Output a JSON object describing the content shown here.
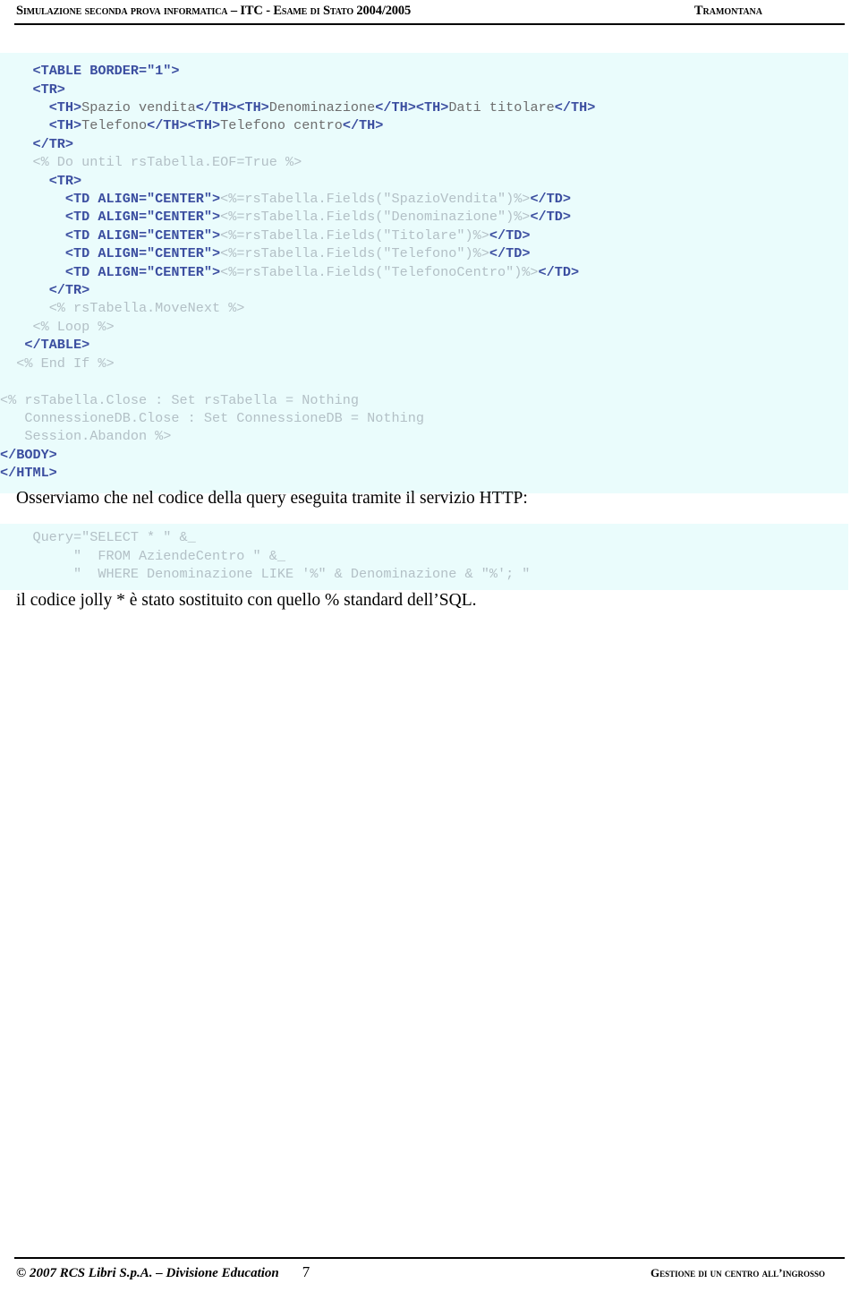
{
  "header": {
    "title": "Simulazione seconda prova informatica – ITC - Esame di Stato 2004/2005",
    "publisher": "Tramontana"
  },
  "code_block_1": {
    "lines": [
      [
        {
          "t": "plain",
          "v": "    "
        },
        {
          "t": "tag",
          "v": "<TABLE BORDER=\"1\">"
        }
      ],
      [
        {
          "t": "plain",
          "v": "    "
        },
        {
          "t": "tag",
          "v": "<TR>"
        }
      ],
      [
        {
          "t": "plain",
          "v": "      "
        },
        {
          "t": "tag",
          "v": "<TH>"
        },
        {
          "t": "text",
          "v": "Spazio vendita"
        },
        {
          "t": "tag",
          "v": "</TH><TH>"
        },
        {
          "t": "text",
          "v": "Denominazione"
        },
        {
          "t": "tag",
          "v": "</TH><TH>"
        },
        {
          "t": "text",
          "v": "Dati titolare"
        },
        {
          "t": "tag",
          "v": "</TH>"
        }
      ],
      [
        {
          "t": "plain",
          "v": "      "
        },
        {
          "t": "tag",
          "v": "<TH>"
        },
        {
          "t": "text",
          "v": "Telefono"
        },
        {
          "t": "tag",
          "v": "</TH><TH>"
        },
        {
          "t": "text",
          "v": "Telefono centro"
        },
        {
          "t": "tag",
          "v": "</TH>"
        }
      ],
      [
        {
          "t": "plain",
          "v": "    "
        },
        {
          "t": "tag",
          "v": "</TR>"
        }
      ],
      [
        {
          "t": "plain",
          "v": "    "
        },
        {
          "t": "asp",
          "v": "<% Do until rsTabella.EOF=True %>"
        }
      ],
      [
        {
          "t": "plain",
          "v": "      "
        },
        {
          "t": "tag",
          "v": "<TR>"
        }
      ],
      [
        {
          "t": "plain",
          "v": "        "
        },
        {
          "t": "tag",
          "v": "<TD ALIGN=\"CENTER\">"
        },
        {
          "t": "asp",
          "v": "<%=rsTabella.Fields(\"SpazioVendita\")%>"
        },
        {
          "t": "tag",
          "v": "</TD>"
        }
      ],
      [
        {
          "t": "plain",
          "v": "        "
        },
        {
          "t": "tag",
          "v": "<TD ALIGN=\"CENTER\">"
        },
        {
          "t": "asp",
          "v": "<%=rsTabella.Fields(\"Denominazione\")%>"
        },
        {
          "t": "tag",
          "v": "</TD>"
        }
      ],
      [
        {
          "t": "plain",
          "v": "        "
        },
        {
          "t": "tag",
          "v": "<TD ALIGN=\"CENTER\">"
        },
        {
          "t": "asp",
          "v": "<%=rsTabella.Fields(\"Titolare\")%>"
        },
        {
          "t": "tag",
          "v": "</TD>"
        }
      ],
      [
        {
          "t": "plain",
          "v": "        "
        },
        {
          "t": "tag",
          "v": "<TD ALIGN=\"CENTER\">"
        },
        {
          "t": "asp",
          "v": "<%=rsTabella.Fields(\"Telefono\")%>"
        },
        {
          "t": "tag",
          "v": "</TD>"
        }
      ],
      [
        {
          "t": "plain",
          "v": "        "
        },
        {
          "t": "tag",
          "v": "<TD ALIGN=\"CENTER\">"
        },
        {
          "t": "asp",
          "v": "<%=rsTabella.Fields(\"TelefonoCentro\")%>"
        },
        {
          "t": "tag",
          "v": "</TD>"
        }
      ],
      [
        {
          "t": "plain",
          "v": "      "
        },
        {
          "t": "tag",
          "v": "</TR>"
        }
      ],
      [
        {
          "t": "plain",
          "v": "      "
        },
        {
          "t": "asp",
          "v": "<% rsTabella.MoveNext %>"
        }
      ],
      [
        {
          "t": "plain",
          "v": "    "
        },
        {
          "t": "asp",
          "v": "<% Loop %>"
        }
      ],
      [
        {
          "t": "plain",
          "v": "   "
        },
        {
          "t": "tag",
          "v": "</TABLE>"
        }
      ],
      [
        {
          "t": "plain",
          "v": "  "
        },
        {
          "t": "asp",
          "v": "<% End If %>"
        }
      ],
      [
        {
          "t": "plain",
          "v": ""
        }
      ],
      [
        {
          "t": "asp",
          "v": "<% rsTabella.Close : Set rsTabella = Nothing"
        }
      ],
      [
        {
          "t": "asp",
          "v": "   ConnessioneDB.Close : Set ConnessioneDB = Nothing"
        }
      ],
      [
        {
          "t": "asp",
          "v": "   Session.Abandon %>"
        }
      ],
      [
        {
          "t": "tag",
          "v": "</BODY>"
        }
      ],
      [
        {
          "t": "tag",
          "v": "</HTML>"
        }
      ]
    ]
  },
  "paragraph_1": "Osserviamo che nel codice della query eseguita tramite il servizio HTTP:",
  "code_block_2": {
    "lines": [
      [
        {
          "t": "asp",
          "v": "    Query=\"SELECT * \" &_"
        }
      ],
      [
        {
          "t": "asp",
          "v": "         \"  FROM AziendeCentro \" &_"
        }
      ],
      [
        {
          "t": "asp",
          "v": "         \"  WHERE Denominazione LIKE '%\" & Denominazione & \"%'; \""
        }
      ]
    ]
  },
  "paragraph_2": "il codice jolly * è stato sostituito con quello % standard dell’SQL.",
  "footer": {
    "copyright": "© 2007 RCS Libri S.p.A. – Divisione Education",
    "page_number": "7",
    "section": "Gestione di un centro all’ingrosso"
  },
  "colors": {
    "code_background": "#eafcfc",
    "tag_color": "#3b4ea0",
    "asp_color": "#b3c0c6",
    "text_color": "#6d6d6d",
    "page_background": "#ffffff"
  }
}
